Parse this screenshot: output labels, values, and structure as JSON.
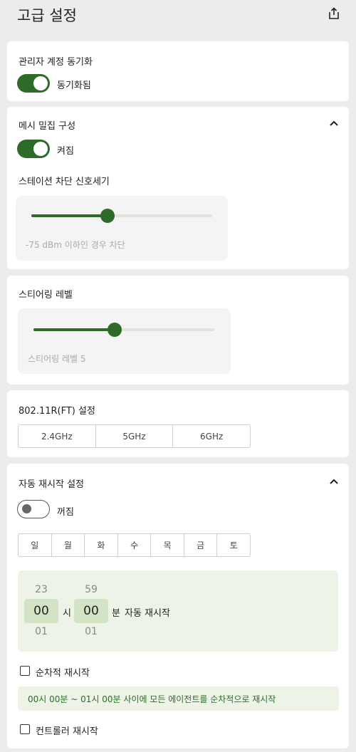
{
  "header": {
    "title": "고급 설정",
    "share_icon": "share-icon"
  },
  "admin_sync": {
    "title": "관리자 계정 동기화",
    "toggle_on": true,
    "toggle_label": "동기화됨"
  },
  "mesh": {
    "title": "메시 밀집 구성",
    "toggle_on": true,
    "toggle_label": "켜짐",
    "block_title": "스테이션 차단 신호세기",
    "slider_level": 0.42,
    "slider_text": "-75 dBm 이하인 경우 차단"
  },
  "steering": {
    "title": "스티어링 레벨",
    "slider_level": 0.45,
    "slider_text": "스티어링 레벨 5"
  },
  "ft": {
    "title": "802.11R(FT) 설정",
    "bands": [
      "2.4GHz",
      "5GHz",
      "6GHz"
    ]
  },
  "restart": {
    "title": "자동 재시작 설정",
    "toggle_on": false,
    "toggle_label": "꺼짐",
    "days": [
      "일",
      "월",
      "화",
      "수",
      "목",
      "금",
      "토"
    ],
    "hour_prev": "23",
    "hour_selected": "00",
    "hour_next": "01",
    "hour_unit": "시",
    "minute_prev": "59",
    "minute_selected": "00",
    "minute_next": "01",
    "minute_unit": "분",
    "suffix": "자동 재시작",
    "sequential_label": "순차적 재시작",
    "sequential_checked": false,
    "info_text": "00시 00분 ~ 01시 00분 사이에 모든 에이전트를 순차적으로 재시작",
    "controller_label": "컨트롤러 재시작",
    "controller_checked": false
  }
}
